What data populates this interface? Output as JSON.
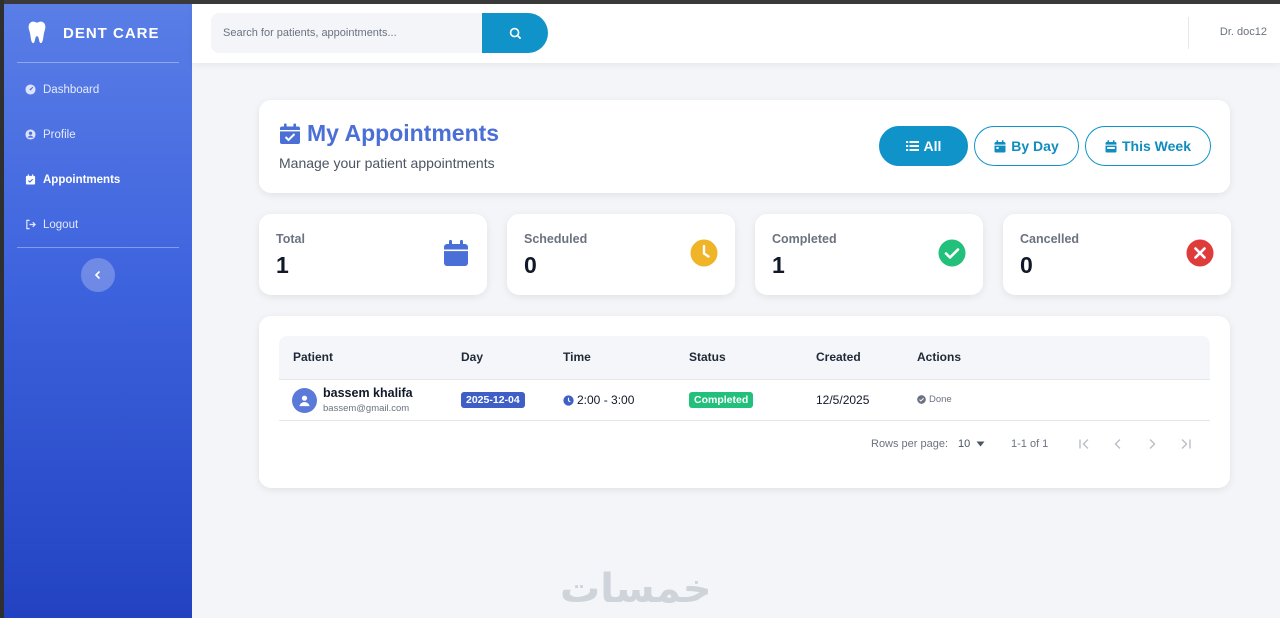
{
  "app": {
    "brand": "DENT CARE",
    "colors": {
      "primary": "#0f93c9",
      "title": "#4a6fd6",
      "sidebar_top": "#5a7ee6",
      "sidebar_bottom": "#2242c2"
    }
  },
  "sidebar": {
    "items": [
      {
        "label": "Dashboard",
        "icon": "dashboard-icon",
        "active": false
      },
      {
        "label": "Profile",
        "icon": "user-circle-icon",
        "active": false
      },
      {
        "label": "Appointments",
        "icon": "calendar-check-icon",
        "active": true
      },
      {
        "label": "Logout",
        "icon": "logout-icon",
        "active": false
      }
    ],
    "collapse_icon": "chevron-left-icon"
  },
  "header": {
    "search_placeholder": "Search for patients, appointments...",
    "user": "Dr. doc12"
  },
  "page": {
    "title": "My Appointments",
    "subtitle": "Manage your patient appointments",
    "filters": [
      {
        "label": "All",
        "icon": "list-icon",
        "active": true
      },
      {
        "label": "By Day",
        "icon": "calendar-icon",
        "active": false
      },
      {
        "label": "This Week",
        "icon": "calendar-week-icon",
        "active": false
      }
    ]
  },
  "stats": [
    {
      "label": "Total",
      "value": "1",
      "icon": "calendar-icon",
      "color": "#4a6fd6"
    },
    {
      "label": "Scheduled",
      "value": "0",
      "icon": "clock-icon",
      "color": "#f0b429"
    },
    {
      "label": "Completed",
      "value": "1",
      "icon": "check-circle-icon",
      "color": "#22c07a"
    },
    {
      "label": "Cancelled",
      "value": "0",
      "icon": "x-circle-icon",
      "color": "#e03b3b"
    }
  ],
  "table": {
    "columns": [
      "Patient",
      "Day",
      "Time",
      "Status",
      "Created",
      "Actions"
    ],
    "rows": [
      {
        "patient_name": "bassem khalifa",
        "patient_email": "bassem@gmail.com",
        "day": "2025-12-04",
        "time": "2:00 - 3:00",
        "status": "Completed",
        "created": "12/5/2025",
        "action": "Done"
      }
    ],
    "pagination": {
      "rows_per_page_label": "Rows per page:",
      "rows_per_page": "10",
      "range": "1-1 of 1"
    }
  },
  "watermark": "خمسات"
}
